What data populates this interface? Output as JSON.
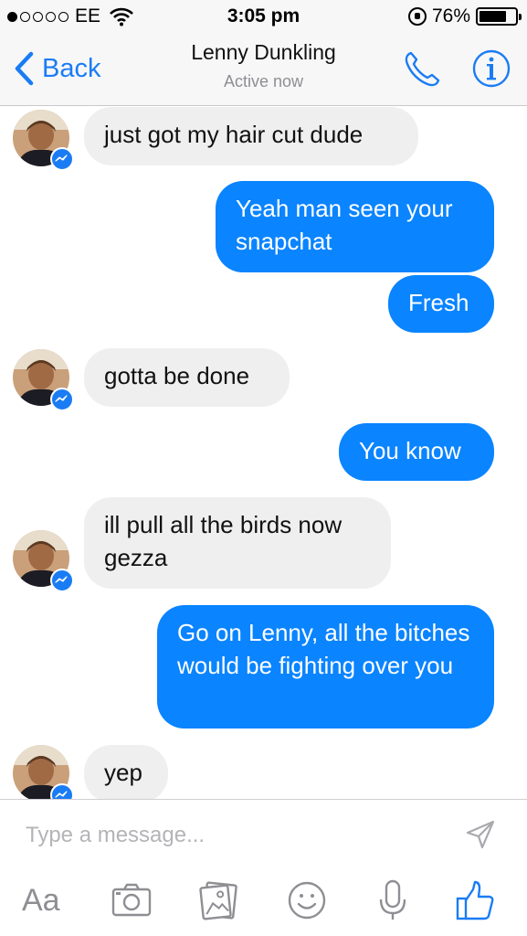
{
  "status_bar": {
    "carrier": "EE",
    "time": "3:05 pm",
    "battery": "76%",
    "battery_level": 0.76
  },
  "header": {
    "back_label": "Back",
    "contact_name": "Lenny Dunkling",
    "status": "Active now",
    "icons": [
      "chevron-left-icon",
      "phone-icon",
      "info-icon"
    ]
  },
  "messages": [
    {
      "from": "them",
      "text": "just got my hair cut dude"
    },
    {
      "from": "me",
      "text": "Yeah man seen your snapchat"
    },
    {
      "from": "me",
      "text": "Fresh"
    },
    {
      "from": "them",
      "text": "gotta be done"
    },
    {
      "from": "me",
      "text": "You know"
    },
    {
      "from": "them",
      "text": "ill pull all the birds now gezza"
    },
    {
      "from": "me",
      "text": "Go on Lenny, all the bitches would be fighting over you"
    },
    {
      "from": "them",
      "text": "yep"
    }
  ],
  "composer": {
    "placeholder": "Type a message...",
    "text_tool_label": "Aa",
    "tools": [
      "camera-icon",
      "photo-icon",
      "emoji-icon",
      "microphone-icon",
      "like-icon"
    ]
  },
  "colors": {
    "accent": "#1a7cf4",
    "outgoing_bubble": "#0a84ff",
    "incoming_bubble": "#efefef"
  }
}
